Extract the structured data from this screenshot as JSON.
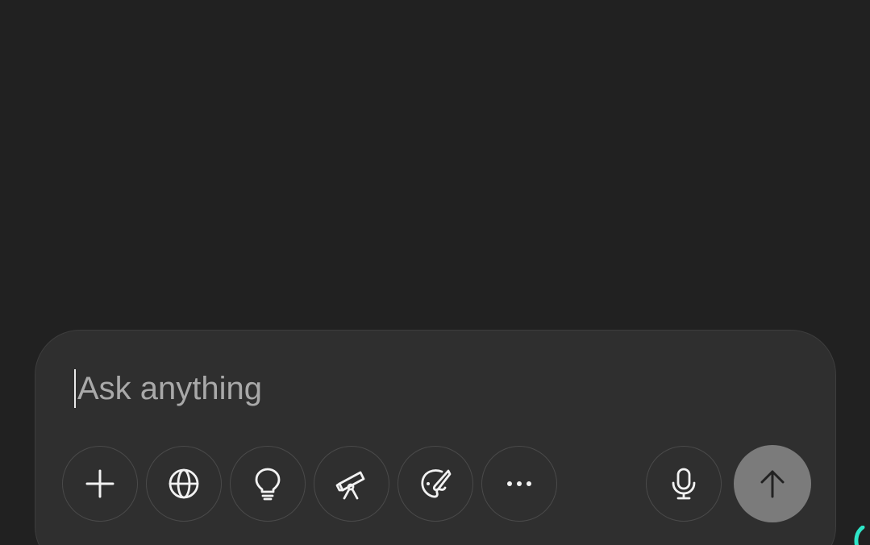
{
  "composer": {
    "placeholder": "Ask anything",
    "value": ""
  },
  "tools": [
    {
      "name": "add",
      "icon": "plus-icon"
    },
    {
      "name": "search",
      "icon": "globe-icon"
    },
    {
      "name": "reason",
      "icon": "lightbulb-icon"
    },
    {
      "name": "deep-research",
      "icon": "telescope-icon"
    },
    {
      "name": "create-image",
      "icon": "palette-icon"
    },
    {
      "name": "more",
      "icon": "ellipsis-icon"
    },
    {
      "name": "voice",
      "icon": "microphone-icon"
    }
  ],
  "send": {
    "icon": "arrow-up-icon"
  },
  "colors": {
    "background": "#212121",
    "composer": "#2f2f2f",
    "border": "#4a4a4a",
    "icon": "#f2f2f2",
    "placeholder": "#a9a9a9",
    "send_disabled": "#7b7b7b",
    "accent": "#2ee6c8"
  }
}
